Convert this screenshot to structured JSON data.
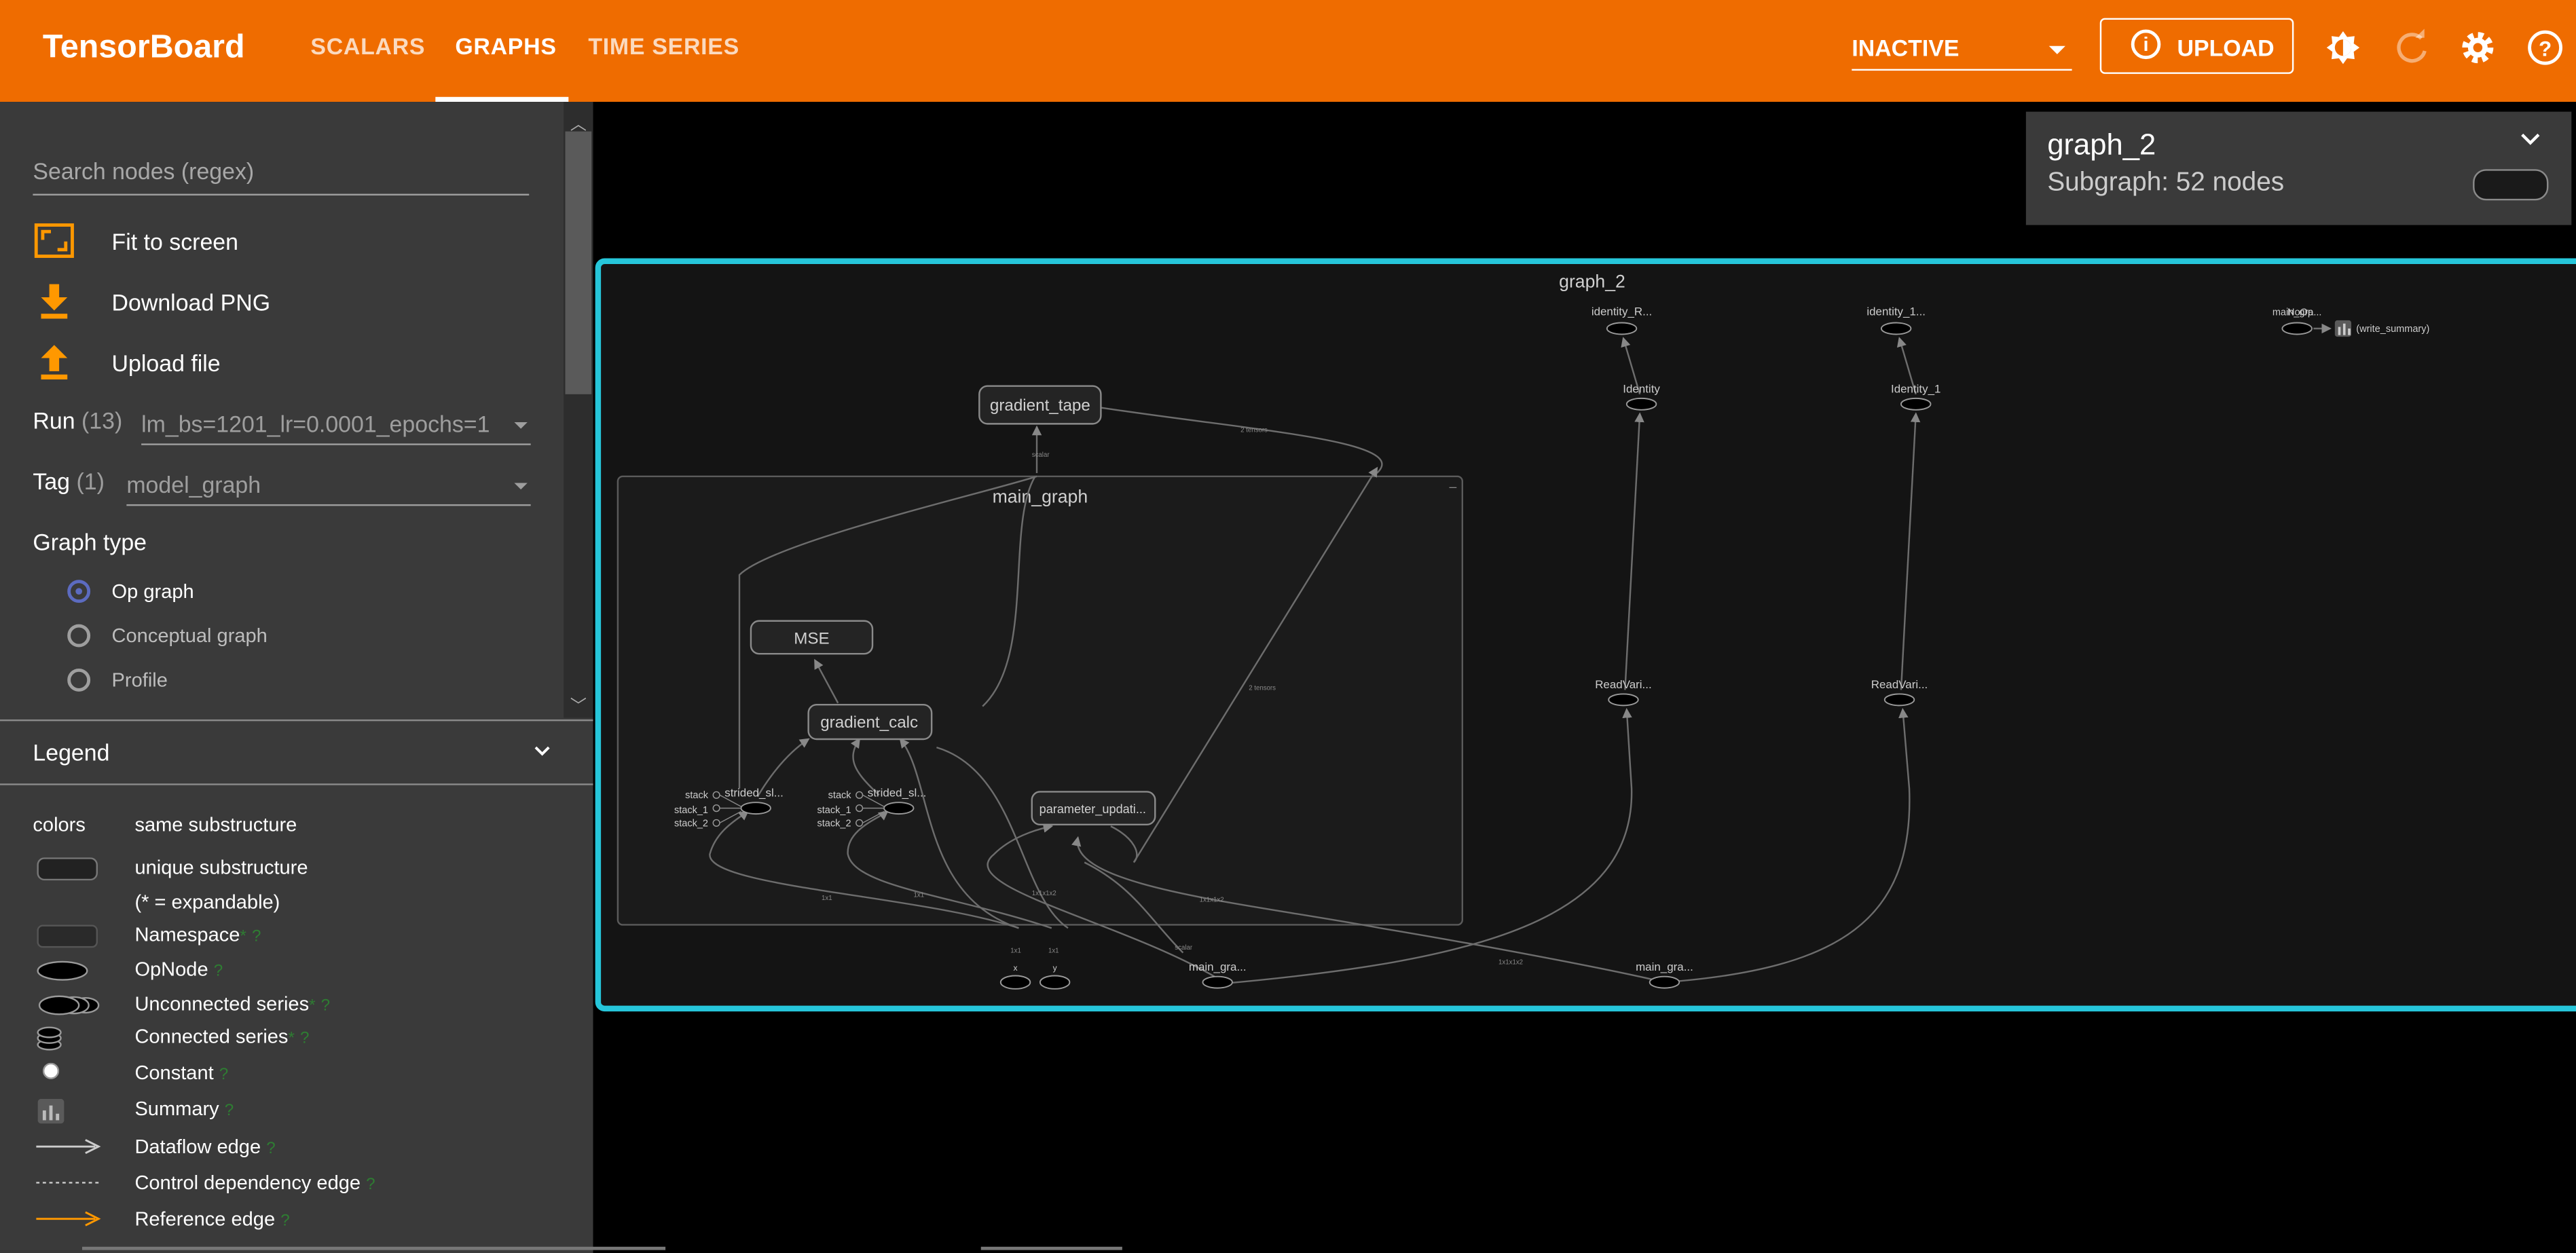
{
  "app": {
    "brand": "TensorBoard",
    "tabs": [
      {
        "label": "SCALARS",
        "active": false
      },
      {
        "label": "GRAPHS",
        "active": true
      },
      {
        "label": "TIME SERIES",
        "active": false
      }
    ],
    "run_status": "INACTIVE",
    "upload_label": "UPLOAD",
    "accent_color": "#ef6c00",
    "icons": [
      "info-icon",
      "brightness-icon",
      "refresh-icon",
      "settings-icon",
      "help-icon"
    ]
  },
  "sidebar": {
    "search_placeholder": "Search nodes (regex)",
    "actions": [
      {
        "label": "Fit to screen",
        "icon": "fit-to-screen-icon"
      },
      {
        "label": "Download PNG",
        "icon": "download-icon"
      },
      {
        "label": "Upload file",
        "icon": "upload-icon"
      }
    ],
    "run": {
      "label": "Run",
      "count": "(13)",
      "value": "lm_bs=1201_lr=0.0001_epochs=1"
    },
    "tag": {
      "label": "Tag",
      "count": "(1)",
      "value": "model_graph"
    },
    "graph_type": {
      "title": "Graph type",
      "options": [
        {
          "label": "Op graph",
          "selected": true
        },
        {
          "label": "Conceptual graph",
          "selected": false
        },
        {
          "label": "Profile",
          "selected": false
        }
      ]
    },
    "legend": {
      "title": "Legend",
      "colors_label": "colors",
      "colors_value": "same substructure",
      "items": [
        {
          "label": "unique substructure"
        },
        {
          "label": "(* = expandable)"
        },
        {
          "label": "Namespace",
          "suffix": "*",
          "help": "?"
        },
        {
          "label": "OpNode",
          "help": "?"
        },
        {
          "label": "Unconnected series",
          "suffix": "*",
          "help": "?"
        },
        {
          "label": "Connected series",
          "suffix": "*",
          "help": "?"
        },
        {
          "label": "Constant",
          "help": "?"
        },
        {
          "label": "Summary",
          "help": "?"
        },
        {
          "label": "Dataflow edge",
          "help": "?"
        },
        {
          "label": "Control dependency edge",
          "help": "?"
        },
        {
          "label": "Reference edge",
          "help": "?"
        }
      ]
    }
  },
  "info_card": {
    "title": "graph_2",
    "subtitle": "Subgraph: 52 nodes"
  },
  "graph": {
    "root_label": "graph_2",
    "main_graph_label": "main_graph",
    "nodes": {
      "gradient_tape": "gradient_tape",
      "mse": "MSE",
      "gradient_calc": "gradient_calc",
      "parameter_update": "parameter_updati...",
      "strided_1": "strided_sl...",
      "strided_2": "strided_sl...",
      "stack": "stack",
      "stack_1": "stack_1",
      "stack_2": "stack_2",
      "identity_r": "identity_R...",
      "identity_1_top": "identity_1...",
      "identity": "Identity",
      "identity_1": "Identity_1",
      "readvar_1": "ReadVari...",
      "readvar_2": "ReadVari...",
      "main_gra_1": "main_gra...",
      "main_gra_2": "main_gra...",
      "main_gra_top": "main_gra...",
      "no_op": "NoOp",
      "write_summary": "(write_summary)",
      "x": "x",
      "y": "y"
    },
    "edge_labels": {
      "tensors": "2 tensors",
      "scalar": "scalar",
      "tensor_2": "2 tensors",
      "one_x": "1x1",
      "one_y": "1x1",
      "grad_left": "1x1",
      "grad_right": "1x1",
      "param_1": "1x1x1x2",
      "param_2": "1x1x1x2",
      "bottom": "1x1x1x2",
      "scalar_b": "scalar"
    }
  }
}
